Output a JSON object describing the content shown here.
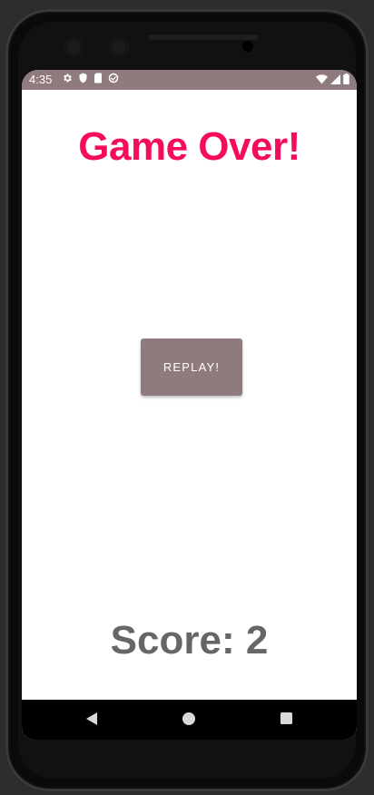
{
  "status_bar": {
    "time": "4:35",
    "background_color": "#8f7b7d",
    "left_icons": [
      "settings-icon",
      "shield-icon",
      "sim-card-icon",
      "data-saver-icon"
    ],
    "right_icons": [
      "wifi-icon",
      "signal-icon",
      "battery-icon"
    ]
  },
  "game": {
    "title": "Game Over!",
    "title_color": "#f50d5b",
    "replay_label": "REPLAY!",
    "button_color": "#8f7b7d",
    "score_text": "Score: 2",
    "score_color": "#666666"
  },
  "nav_bar": {
    "icons": [
      "back-icon",
      "home-icon",
      "recents-icon"
    ]
  }
}
